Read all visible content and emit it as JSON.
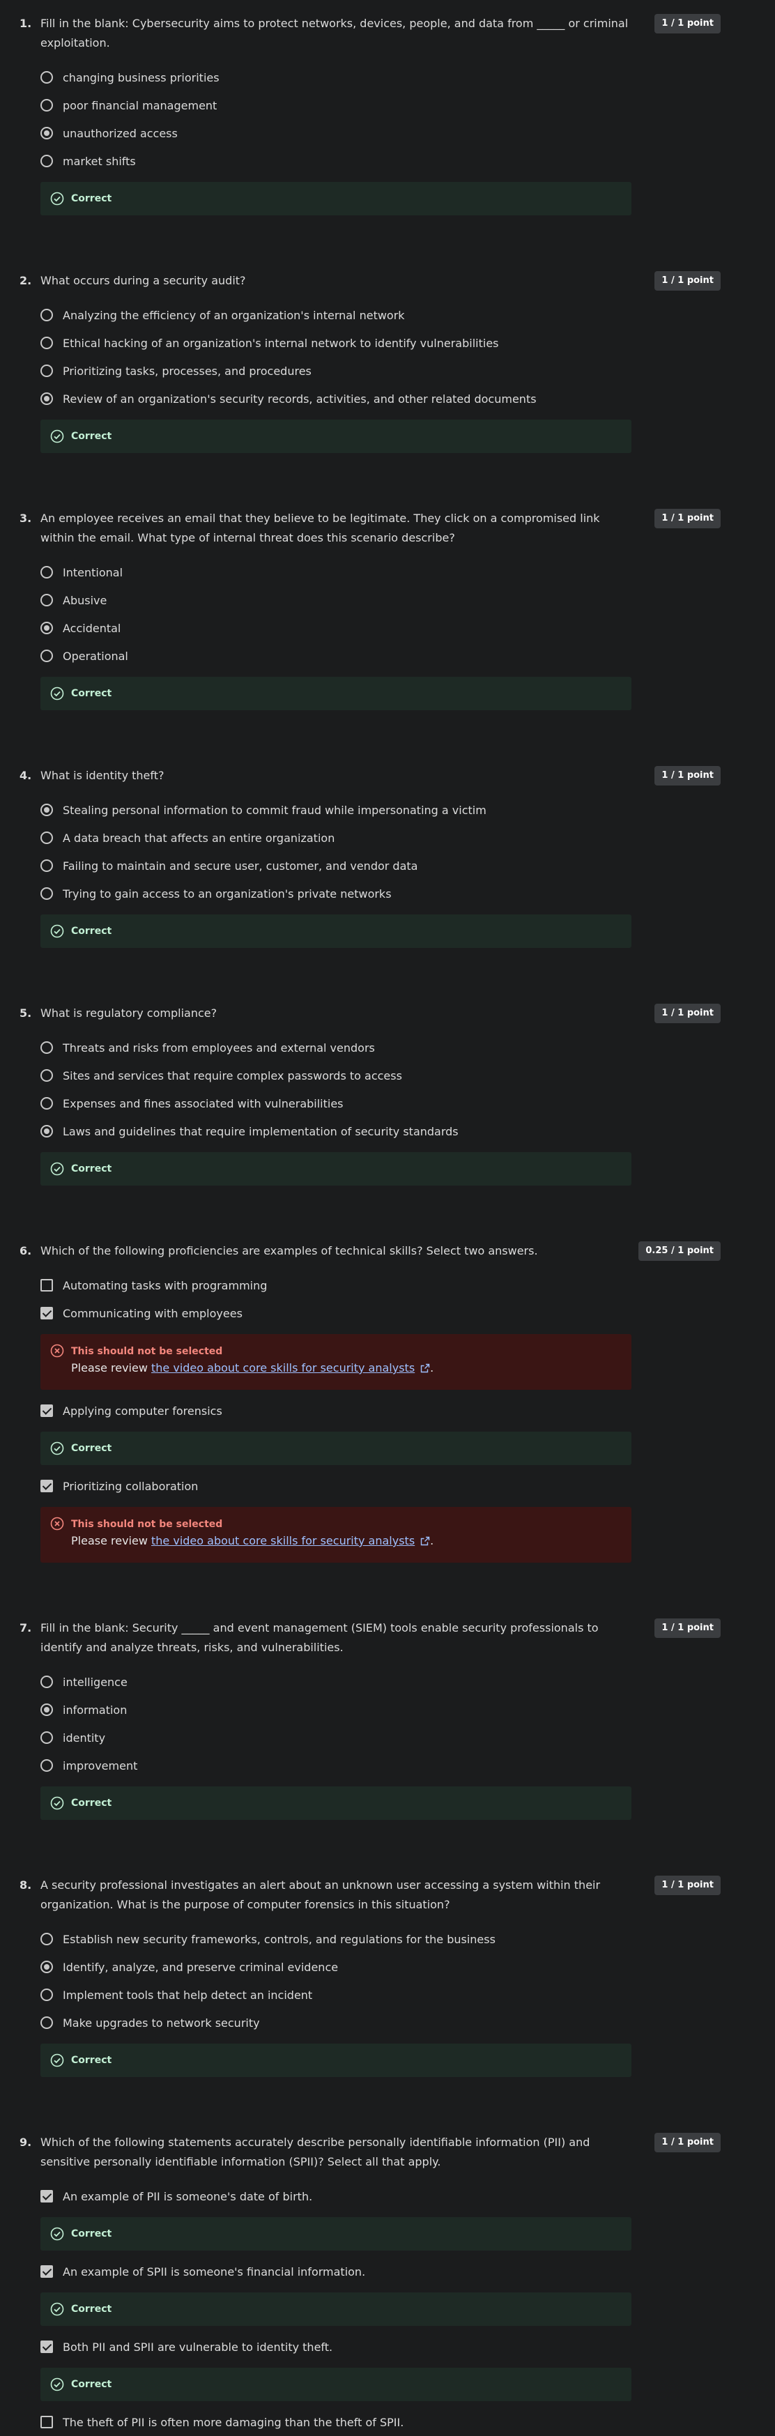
{
  "feedback_messages": {
    "correct": "Correct",
    "wrong_title": "This should not be selected",
    "review_prefix": "Please review ",
    "review_link": "the video about core skills for security analysts",
    "review_suffix": "."
  },
  "colors": {
    "background": "#1b1c1d",
    "correct_bg": "#1e2a25",
    "correct_text": "#c3f0d5",
    "wrong_bg": "#3a1514",
    "wrong_text": "#f3867d",
    "link": "#9ec0ff",
    "points_badge_bg": "#3b3d40"
  },
  "questions": [
    {
      "number": "1.",
      "text": "Fill in the blank: Cybersecurity aims to protect networks, devices, people, and data from _____ or criminal exploitation.",
      "points": "1 / 1 point",
      "type": "radio",
      "options": [
        {
          "text": "changing business priorities",
          "selected": false
        },
        {
          "text": "poor financial management",
          "selected": false
        },
        {
          "text": "unauthorized access",
          "selected": true,
          "feedback": "correct"
        },
        {
          "text": "market shifts",
          "selected": false
        }
      ],
      "trailing_feedback": "correct"
    },
    {
      "number": "2.",
      "text": "What occurs during a security audit?",
      "points": "1 / 1 point",
      "type": "radio",
      "options": [
        {
          "text": "Analyzing the efficiency of an organization's internal network",
          "selected": false
        },
        {
          "text": "Ethical hacking of an organization's internal network to identify vulnerabilities",
          "selected": false
        },
        {
          "text": "Prioritizing tasks, processes, and procedures",
          "selected": false
        },
        {
          "text": "Review of an organization's security records, activities, and other related documents",
          "selected": true
        }
      ],
      "trailing_feedback": "correct"
    },
    {
      "number": "3.",
      "text": "An employee receives an email that they believe to be legitimate. They click on a compromised link within the email. What type of internal threat does this scenario describe?",
      "points": "1 / 1 point",
      "type": "radio",
      "options": [
        {
          "text": "Intentional",
          "selected": false
        },
        {
          "text": "Abusive",
          "selected": false
        },
        {
          "text": "Accidental",
          "selected": true
        },
        {
          "text": "Operational",
          "selected": false
        }
      ],
      "trailing_feedback": "correct"
    },
    {
      "number": "4.",
      "text": "What is identity theft?",
      "points": "1 / 1 point",
      "type": "radio",
      "options": [
        {
          "text": "Stealing personal information to commit fraud while impersonating a victim",
          "selected": true
        },
        {
          "text": "A data breach that affects an entire organization",
          "selected": false
        },
        {
          "text": "Failing to maintain and secure user, customer, and vendor data",
          "selected": false
        },
        {
          "text": "Trying to gain access to an organization's private networks",
          "selected": false
        }
      ],
      "trailing_feedback": "correct"
    },
    {
      "number": "5.",
      "text": "What is regulatory compliance?",
      "points": "1 / 1 point",
      "type": "radio",
      "options": [
        {
          "text": "Threats and risks from employees and external vendors",
          "selected": false
        },
        {
          "text": "Sites and services that require complex passwords to access",
          "selected": false
        },
        {
          "text": "Expenses and fines associated with vulnerabilities",
          "selected": false
        },
        {
          "text": "Laws and guidelines that require implementation of security standards",
          "selected": true
        }
      ],
      "trailing_feedback": "correct"
    },
    {
      "number": "6.",
      "text": "Which of the following proficiencies are examples of technical skills? Select two answers.",
      "points": "0.25 / 1 point",
      "type": "checkbox",
      "options": [
        {
          "text": "Automating tasks with programming",
          "selected": false
        },
        {
          "text": "Communicating with employees",
          "selected": true,
          "feedback": "wrong"
        },
        {
          "text": "Applying computer forensics",
          "selected": true,
          "feedback": "correct"
        },
        {
          "text": "Prioritizing collaboration",
          "selected": true,
          "feedback": "wrong"
        }
      ]
    },
    {
      "number": "7.",
      "text": "Fill in the blank: Security _____ and event management (SIEM) tools enable security professionals to identify and analyze threats, risks, and vulnerabilities.",
      "points": "1 / 1 point",
      "type": "radio",
      "options": [
        {
          "text": "intelligence",
          "selected": false
        },
        {
          "text": "information",
          "selected": true
        },
        {
          "text": "identity",
          "selected": false
        },
        {
          "text": "improvement",
          "selected": false
        }
      ],
      "trailing_feedback": "correct"
    },
    {
      "number": "8.",
      "text": "A security professional investigates an alert about an unknown user accessing a system within their organization. What is the purpose of computer forensics in this situation?",
      "points": "1 / 1 point",
      "type": "radio",
      "options": [
        {
          "text": "Establish new security frameworks, controls, and regulations for the business",
          "selected": false
        },
        {
          "text": "Identify, analyze, and preserve criminal evidence",
          "selected": true
        },
        {
          "text": "Implement tools that help detect an incident",
          "selected": false
        },
        {
          "text": "Make upgrades to network security",
          "selected": false
        }
      ],
      "trailing_feedback": "correct"
    },
    {
      "number": "9.",
      "text": "Which of the following statements accurately describe personally identifiable information (PII) and sensitive personally identifiable information (SPII)? Select all that apply.",
      "points": "1 / 1 point",
      "type": "checkbox",
      "options": [
        {
          "text": "An example of PII is someone's date of birth.",
          "selected": true,
          "feedback": "correct"
        },
        {
          "text": "An example of SPII is someone's financial information.",
          "selected": true,
          "feedback": "correct"
        },
        {
          "text": "Both PII and SPII are vulnerable to identity theft.",
          "selected": true,
          "feedback": "correct"
        },
        {
          "text": "The theft of PII is often more damaging than the theft of SPII.",
          "selected": false
        }
      ]
    }
  ]
}
